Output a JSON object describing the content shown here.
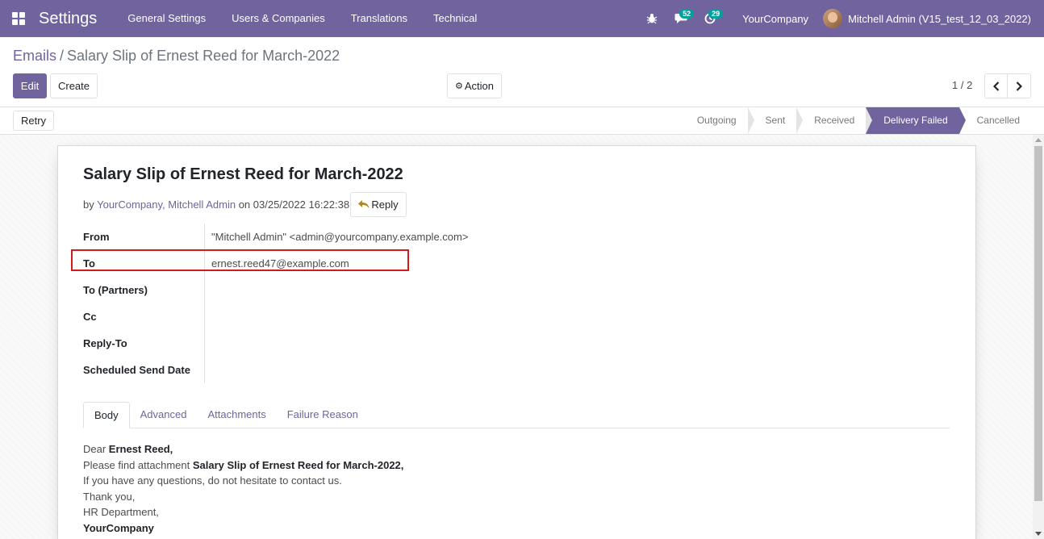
{
  "navbar": {
    "app_title": "Settings",
    "menu": [
      "General Settings",
      "Users & Companies",
      "Translations",
      "Technical"
    ],
    "messages_badge": "52",
    "activities_badge": "29",
    "company": "YourCompany",
    "user": "Mitchell Admin (V15_test_12_03_2022)"
  },
  "breadcrumb": {
    "parent": "Emails",
    "separator": "/",
    "current": "Salary Slip of Ernest Reed for March-2022"
  },
  "toolbar": {
    "edit_label": "Edit",
    "create_label": "Create",
    "action_label": "Action",
    "pager": "1 / 2"
  },
  "statusbar": {
    "retry_label": "Retry",
    "stages": [
      "Outgoing",
      "Sent",
      "Received",
      "Delivery Failed",
      "Cancelled"
    ],
    "active_stage": "Delivery Failed"
  },
  "mail": {
    "subject": "Salary Slip of Ernest Reed for March-2022",
    "by_prefix": "by ",
    "author": "YourCompany, Mitchell Admin",
    "date_text": " on 03/25/2022 16:22:38",
    "reply_label": "Reply",
    "fields": [
      {
        "label": "From",
        "value": "\"Mitchell Admin\" <admin@yourcompany.example.com>"
      },
      {
        "label": "To",
        "value": "ernest.reed47@example.com"
      },
      {
        "label": "To (Partners)",
        "value": ""
      },
      {
        "label": "Cc",
        "value": ""
      },
      {
        "label": "Reply-To",
        "value": ""
      },
      {
        "label": "Scheduled Send Date",
        "value": ""
      }
    ],
    "tabs": [
      "Body",
      "Advanced",
      "Attachments",
      "Failure Reason"
    ],
    "active_tab": "Body",
    "body": {
      "l1_prefix": "Dear ",
      "l1_bold": "Ernest Reed,",
      "l2_prefix": "Please find attachment ",
      "l2_bold": "Salary Slip of Ernest Reed for March-2022,",
      "l3": "If you have any questions, do not hesitate to contact us.",
      "l4": "Thank you,",
      "l5": "HR Department,",
      "l6_bold": "YourCompany"
    }
  },
  "colors": {
    "brand": "#71639e",
    "badge": "#00a09d",
    "highlight": "#d11a1a"
  }
}
